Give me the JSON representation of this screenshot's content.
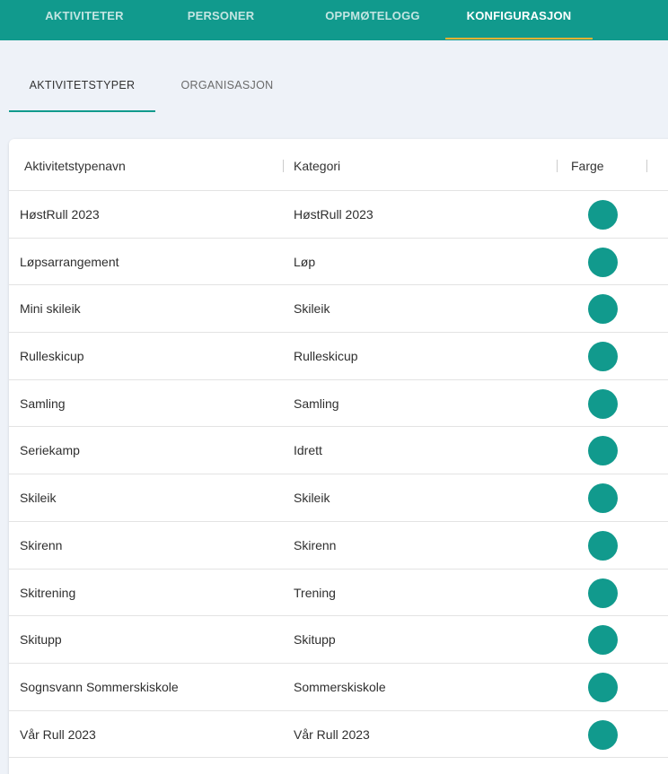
{
  "top_nav": {
    "items": [
      {
        "label": "AKTIVITETER"
      },
      {
        "label": "PERSONER"
      },
      {
        "label": "OPPMØTELOGG"
      },
      {
        "label": "KONFIGURASJON"
      }
    ],
    "active": "KONFIGURASJON",
    "accent_color": "#f2b233",
    "background_color": "#119a8d"
  },
  "sub_tabs": {
    "items": [
      {
        "label": "AKTIVITETSTYPER"
      },
      {
        "label": "ORGANISASJON"
      }
    ],
    "active": "AKTIVITETSTYPER"
  },
  "table": {
    "headers": {
      "name": "Aktivitetstypenavn",
      "category": "Kategori",
      "color": "Farge"
    },
    "rows": [
      {
        "name": "HøstRull 2023",
        "category": "HøstRull 2023",
        "color": "#119a8d"
      },
      {
        "name": "Løpsarrangement",
        "category": "Løp",
        "color": "#119a8d"
      },
      {
        "name": "Mini skileik",
        "category": "Skileik",
        "color": "#119a8d"
      },
      {
        "name": "Rulleskicup",
        "category": "Rulleskicup",
        "color": "#119a8d"
      },
      {
        "name": "Samling",
        "category": "Samling",
        "color": "#119a8d"
      },
      {
        "name": "Seriekamp",
        "category": "Idrett",
        "color": "#119a8d"
      },
      {
        "name": "Skileik",
        "category": "Skileik",
        "color": "#119a8d"
      },
      {
        "name": "Skirenn",
        "category": "Skirenn",
        "color": "#119a8d"
      },
      {
        "name": "Skitrening",
        "category": "Trening",
        "color": "#119a8d"
      },
      {
        "name": "Skitupp",
        "category": "Skitupp",
        "color": "#119a8d"
      },
      {
        "name": "Sognsvann Sommerskiskole",
        "category": "Sommerskiskole",
        "color": "#119a8d"
      },
      {
        "name": "Vår Rull 2023",
        "category": "Vår Rull 2023",
        "color": "#119a8d"
      }
    ]
  }
}
